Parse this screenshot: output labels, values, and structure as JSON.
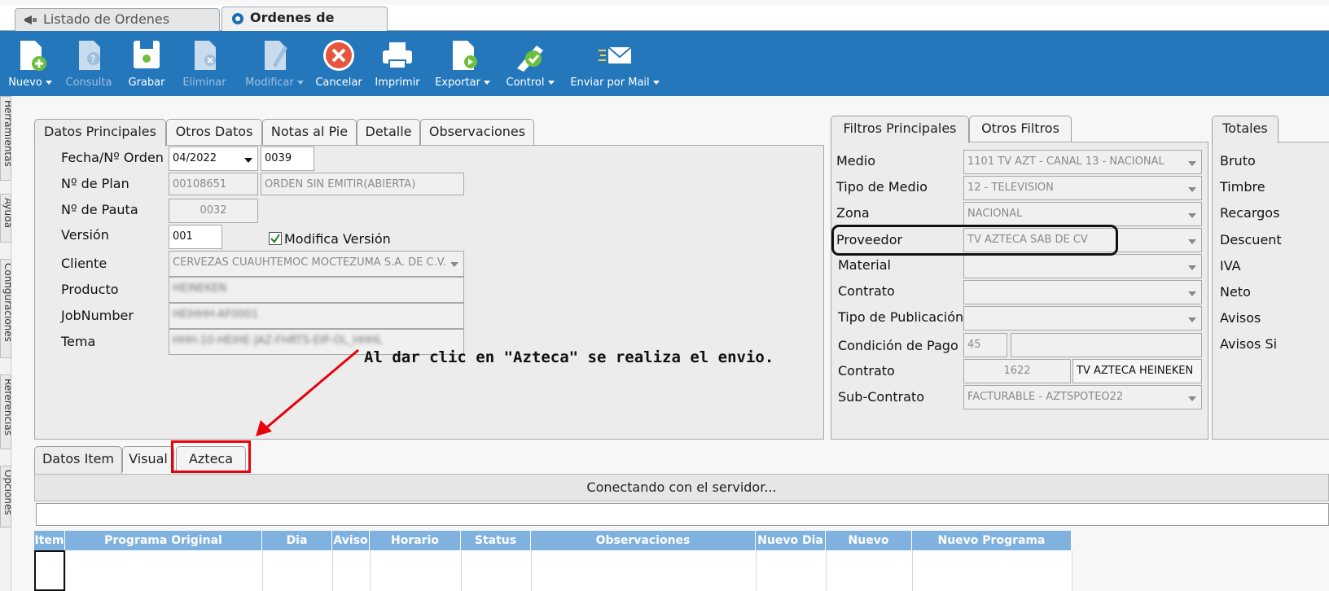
{
  "doc_tabs": [
    {
      "label": "Listado de Ordenes (Completo)"
    },
    {
      "label": "Ordenes de Publicidad"
    }
  ],
  "toolbar": [
    {
      "label": "Nuevo",
      "icon": "new-document-icon",
      "caret": true,
      "enabled": true
    },
    {
      "label": "Consulta",
      "icon": "query-document-icon",
      "caret": false,
      "enabled": false
    },
    {
      "label": "Grabar",
      "icon": "save-icon",
      "caret": false,
      "enabled": true
    },
    {
      "label": "Eliminar",
      "icon": "delete-document-icon",
      "caret": false,
      "enabled": false
    },
    {
      "label": "Modificar",
      "icon": "edit-document-icon",
      "caret": true,
      "enabled": false
    },
    {
      "label": "Cancelar",
      "icon": "cancel-icon",
      "caret": false,
      "enabled": true
    },
    {
      "label": "Imprimir",
      "icon": "printer-icon",
      "caret": false,
      "enabled": true
    },
    {
      "label": "Exportar",
      "icon": "export-icon",
      "caret": true,
      "enabled": true
    },
    {
      "label": "Control",
      "icon": "control-check-icon",
      "caret": true,
      "enabled": true
    },
    {
      "label": "Enviar por Mail",
      "icon": "mail-icon",
      "caret": true,
      "enabled": true
    }
  ],
  "side_tabs": [
    "Herramientas",
    "Ayuda",
    "Configuraciones",
    "Referencias",
    "Opciones"
  ],
  "main_tabs": [
    "Datos Principales",
    "Otros Datos",
    "Notas al Pie",
    "Detalle",
    "Observaciones"
  ],
  "form": {
    "fecha_label": "Fecha/Nº Orden",
    "fecha_value": "04/2022",
    "orden_value": "0039",
    "plan_label": "Nº de Plan",
    "plan_value": "00108651",
    "plan_status": "ORDEN SIN EMITIR(ABIERTA)",
    "pauta_label": "Nº de Pauta",
    "pauta_value": "0032",
    "version_label": "Versión",
    "version_value": "001",
    "modifica_label": "Modifica Versión",
    "modifica_checked": true,
    "cliente_label": "Cliente",
    "cliente_value": "CERVEZAS CUAUHTEMOC MOCTEZUMA S.A. DE C.V.",
    "producto_label": "Producto",
    "producto_value": "HEINEKEN",
    "jobnumber_label": "JobNumber",
    "jobnumber_value": "HEIHHH-AF0001",
    "tema_label": "Tema",
    "tema_value": "HHH-10-HEIHE-JAZ-FHRTS-EIP-OL_HHHL"
  },
  "filter_tabs": [
    "Filtros Principales",
    "Otros Filtros"
  ],
  "filters": [
    {
      "label": "Medio",
      "value": "1101 TV AZT - CANAL 13 - NACIONAL"
    },
    {
      "label": "Tipo de Medio",
      "value": "12 - TELEVISION"
    },
    {
      "label": "Zona",
      "value": "NACIONAL"
    },
    {
      "label": "Proveedor",
      "value": "TV AZTECA SAB DE CV"
    },
    {
      "label": "Material",
      "value": ""
    },
    {
      "label": "Contrato",
      "value": ""
    },
    {
      "label": "Tipo de Publicación",
      "value": ""
    }
  ],
  "condicion": {
    "label": "Condición de Pago",
    "value": "45",
    "value2": ""
  },
  "contrato2": {
    "label": "Contrato",
    "number": "1622",
    "name": "TV AZTECA HEINEKEN"
  },
  "subcontrato": {
    "label": "Sub-Contrato",
    "value": "FACTURABLE - AZTSPOTEO22"
  },
  "totals": {
    "tab": "Totales",
    "labels": [
      "Bruto",
      "Timbre",
      "Recargos",
      "Descuent",
      "IVA",
      "Neto",
      "Avisos",
      "Avisos Si"
    ]
  },
  "annotation": "Al dar clic en \"Azteca\" se realiza el envio.",
  "bottom_tabs": [
    "Datos Item",
    "Visual",
    "Azteca"
  ],
  "status_message": "Conectando con el servidor...",
  "grid_columns": [
    "Item",
    "Programa Original",
    "Dia Original",
    "Aviso",
    "Horario",
    "Status",
    "Observaciones",
    "Nuevo Dia",
    "Nuevo",
    "Nuevo Programa"
  ],
  "colors": {
    "toolbar": "#2577bc",
    "highlight": "#e8000b",
    "grid_header": "#7fb2df"
  }
}
